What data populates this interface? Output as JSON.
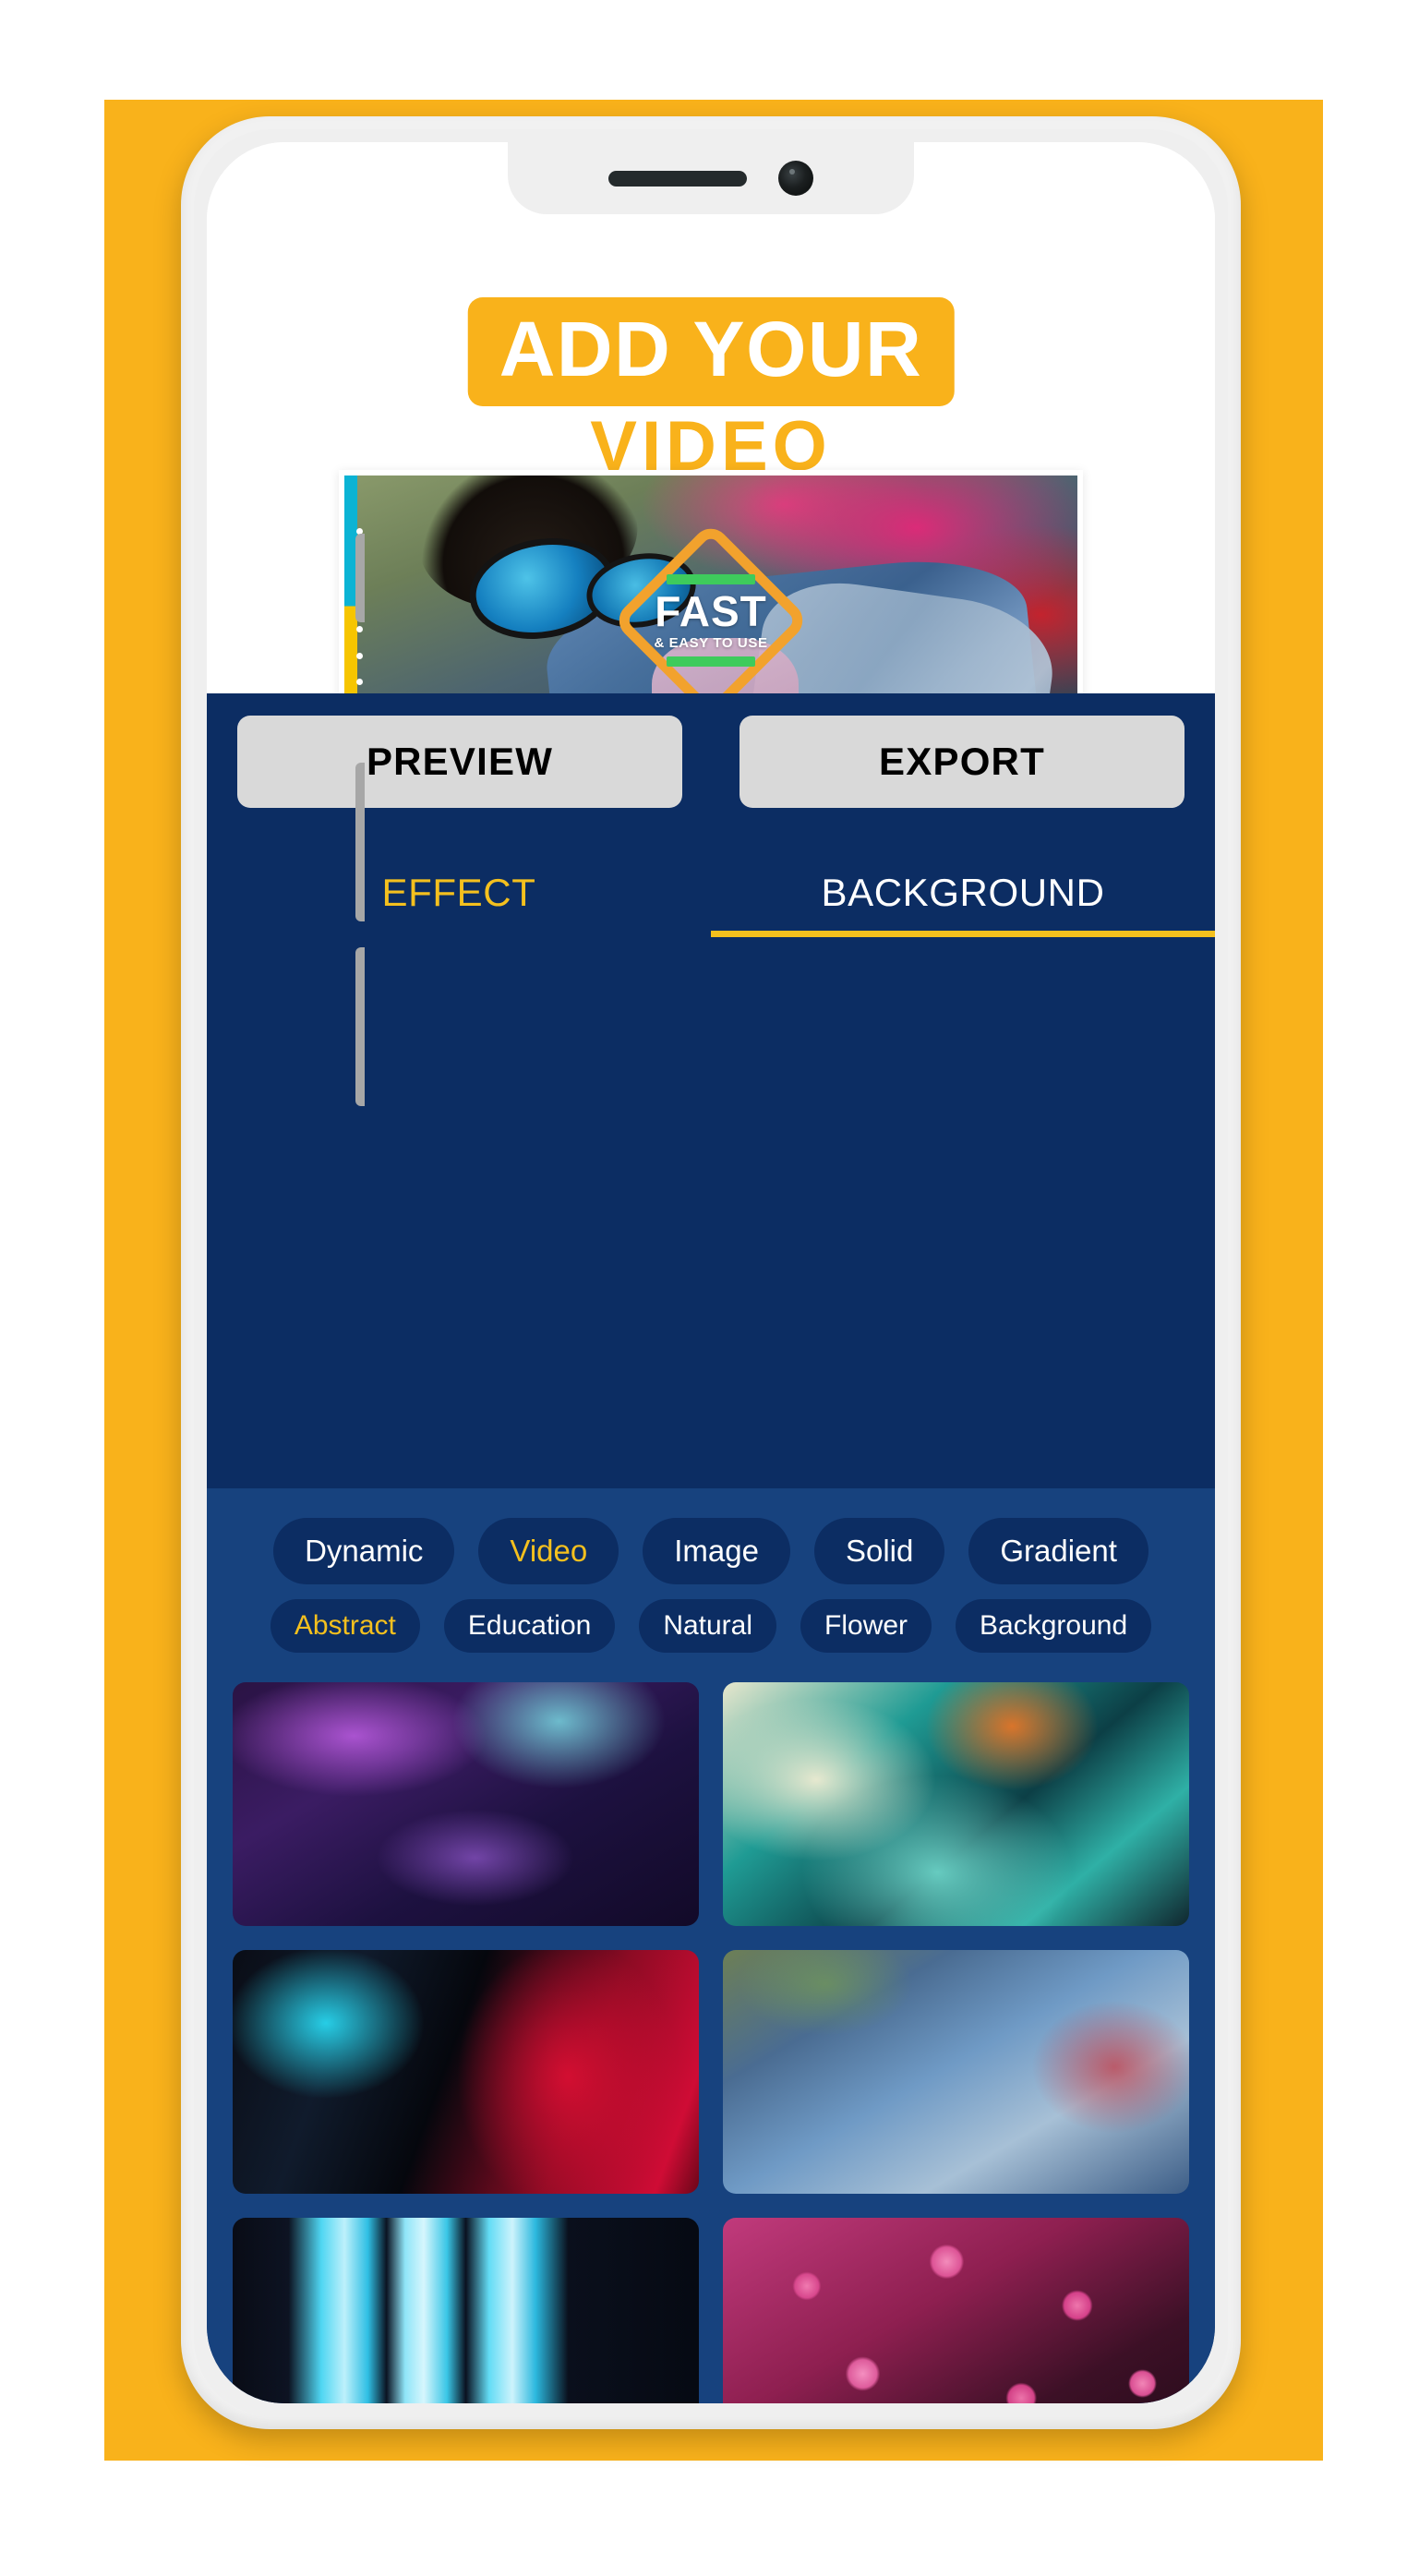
{
  "poster": {
    "accent_yellow": "#F9B21B",
    "panel_navy": "#0C2D63",
    "content_blue": "#17427E"
  },
  "header": {
    "title_line1": "ADD YOUR",
    "title_line2": "VIDEO"
  },
  "preview": {
    "badge": {
      "headline": "FAST",
      "subline": "& EASY TO USE",
      "diamond_color": "#F2A22D",
      "bar_color": "#3ECB5C"
    }
  },
  "actions": [
    {
      "label": "PREVIEW",
      "name": "preview-button"
    },
    {
      "label": "EXPORT",
      "name": "export-button"
    }
  ],
  "tabs": [
    {
      "label": "EFFECT",
      "active": false
    },
    {
      "label": "BACKGROUND",
      "active": true
    }
  ],
  "chips_primary": [
    {
      "label": "Dynamic",
      "selected": false
    },
    {
      "label": "Video",
      "selected": true
    },
    {
      "label": "Image",
      "selected": false
    },
    {
      "label": "Solid",
      "selected": false
    },
    {
      "label": "Gradient",
      "selected": false
    }
  ],
  "chips_secondary": [
    {
      "label": "Abstract",
      "selected": true
    },
    {
      "label": "Education",
      "selected": false
    },
    {
      "label": "Natural",
      "selected": false
    },
    {
      "label": "Flower",
      "selected": false
    },
    {
      "label": "Background",
      "selected": false
    }
  ],
  "gallery": [
    {
      "name": "thumbnail-abstract-purple"
    },
    {
      "name": "thumbnail-abstract-teal"
    },
    {
      "name": "thumbnail-neon-red-cyan"
    },
    {
      "name": "thumbnail-person-denim"
    },
    {
      "name": "thumbnail-blue-light-streaks"
    },
    {
      "name": "thumbnail-pink-flowers"
    }
  ]
}
